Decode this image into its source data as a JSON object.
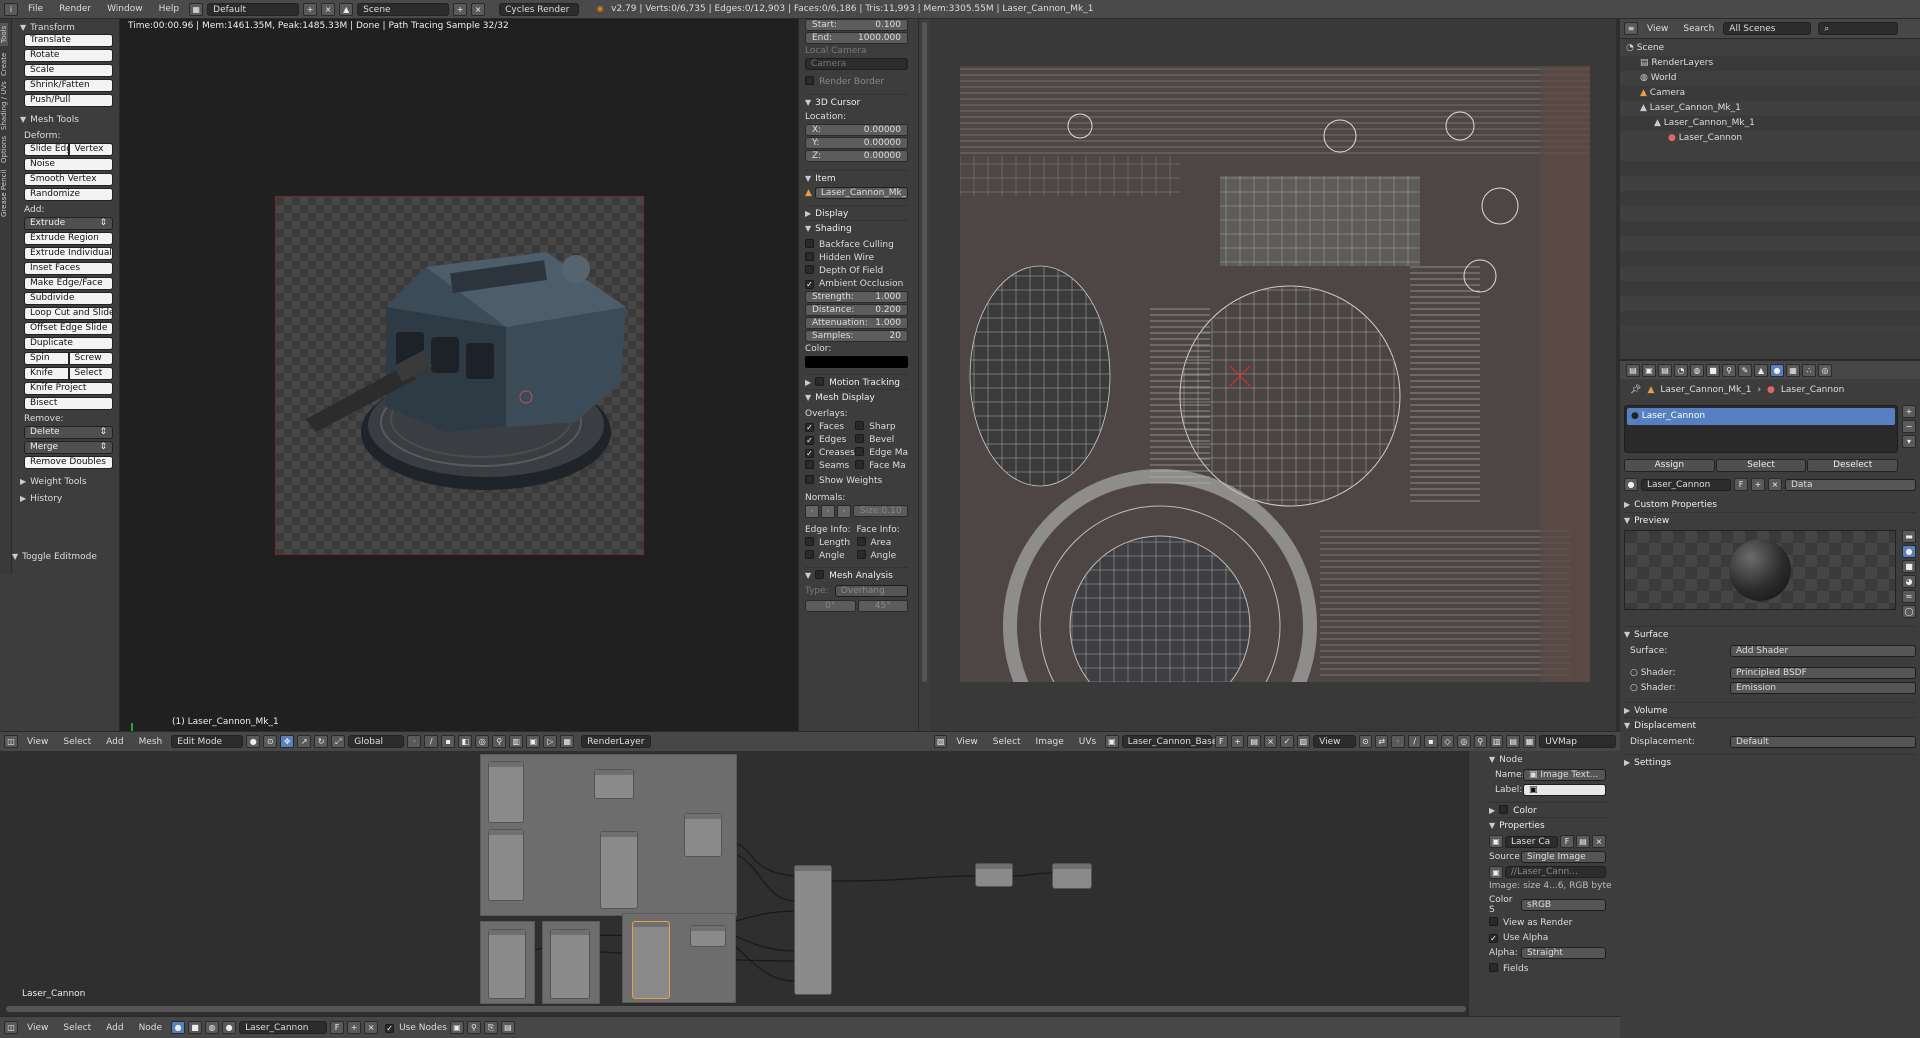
{
  "topbar": {
    "menus": [
      "File",
      "Render",
      "Window",
      "Help"
    ],
    "layout": "Default",
    "scene": "Scene",
    "engine": "Cycles Render",
    "stats": "v2.79 | Verts:0/6,735 | Edges:0/12,903 | Faces:0/6,186 | Tris:11,993 | Mem:3305.55M | Laser_Cannon_Mk_1"
  },
  "tabs": [
    "Tools",
    "Create",
    "Shading / UVs",
    "Options",
    "Grease Pencil"
  ],
  "toolshelf": {
    "transform_title": "Transform",
    "transform": [
      "Translate",
      "Rotate",
      "Scale",
      "Shrink/Fatten",
      "Push/Pull"
    ],
    "mesh_tools_title": "Mesh Tools",
    "deform_label": "Deform:",
    "slide_edge": "Slide Edge",
    "vertex": "Vertex",
    "noise": "Noise",
    "smooth_vertex": "Smooth Vertex",
    "randomize": "Randomize",
    "add_label": "Add:",
    "extrude": "Extrude",
    "add_items": [
      "Extrude Region",
      "Extrude Individual",
      "Inset Faces",
      "Make Edge/Face",
      "Subdivide",
      "Loop Cut and Slide",
      "Offset Edge Slide",
      "Duplicate"
    ],
    "spin": "Spin",
    "screw": "Screw",
    "knife": "Knife",
    "select": "Select",
    "knife_project": "Knife Project",
    "bisect": "Bisect",
    "remove_label": "Remove:",
    "delete": "Delete",
    "merge": "Merge",
    "remove_doubles": "Remove Doubles",
    "weight_tools": "Weight Tools",
    "history": "History",
    "toggle_editmode": "Toggle Editmode"
  },
  "viewport": {
    "status": "Time:00:00.96 | Mem:1461.35M, Peak:1485.33M | Done | Path Tracing Sample 32/32",
    "object_label": "(1) Laser_Cannon_Mk_1"
  },
  "props": {
    "start_label": "Start:",
    "start": "0.100",
    "end_label": "End:",
    "end": "1000.000",
    "local_camera": "Local Camera",
    "camera": "Camera",
    "render_border": "Render Border",
    "cursor_title": "3D Cursor",
    "location": "Location:",
    "x_label": "X:",
    "x": "0.00000",
    "y_label": "Y:",
    "y": "0.00000",
    "z_label": "Z:",
    "z": "0.00000",
    "item_title": "Item",
    "item_name": "Laser_Cannon_Mk_1",
    "display": "Display",
    "shading": "Shading",
    "shading_checks": [
      "Backface Culling",
      "Hidden Wire",
      "Depth Of Field",
      "Ambient Occlusion"
    ],
    "strength_label": "Strength:",
    "strength": "1.000",
    "distance_label": "Distance:",
    "distance": "0.200",
    "attenuation_label": "Attenuation:",
    "attenuation": "1.000",
    "samples_label": "Samples:",
    "samples": "20",
    "color_label": "Color:",
    "motion_tracking": "Motion Tracking",
    "mesh_display": "Mesh Display",
    "overlays": "Overlays:",
    "ov_left": [
      "Faces",
      "Edges",
      "Creases",
      "Seams"
    ],
    "ov_right": [
      "Sharp",
      "Bevel",
      "Edge Ma",
      "Face Ma"
    ],
    "show_weights": "Show Weights",
    "normals": "Normals:",
    "size": "Size:",
    "size_val": "0.10",
    "edge_info": "Edge Info:",
    "face_info": "Face Info:",
    "length": "Length",
    "area": "Area",
    "angle1": "Angle",
    "angle2": "Angle",
    "mesh_analysis": "Mesh Analysis",
    "type_label": "Type:",
    "type": "Overhang",
    "deg0": "0°",
    "deg45": "45°"
  },
  "view3d_header": {
    "view": "View",
    "select": "Select",
    "add": "Add",
    "mesh": "Mesh",
    "mode": "Edit Mode",
    "orientation": "Global",
    "layer": "RenderLayer"
  },
  "uv_header": {
    "view": "View",
    "select": "Select",
    "image": "Image",
    "uvs": "UVs",
    "image_name": "Laser_Cannon_Base...",
    "f": "F",
    "view2": "View",
    "uvmap": "UVMap"
  },
  "outliner": {
    "view": "View",
    "search": "Search",
    "filter": "All Scenes",
    "rows": [
      {
        "name": "Scene",
        "indent": 0
      },
      {
        "name": "RenderLayers",
        "indent": 1
      },
      {
        "name": "World",
        "indent": 1
      },
      {
        "name": "Camera",
        "indent": 1
      },
      {
        "name": "Laser_Cannon_Mk_1",
        "indent": 1
      },
      {
        "name": "Laser_Cannon_Mk_1",
        "indent": 2
      },
      {
        "name": "Laser_Cannon",
        "indent": 3
      }
    ]
  },
  "material": {
    "breadcrumb_obj": "Laser_Cannon_Mk_1",
    "breadcrumb_mat": "Laser_Cannon",
    "slot": "Laser_Cannon",
    "assign": "Assign",
    "select": "Select",
    "deselect": "Deselect",
    "mat_name": "Laser_Cannon",
    "f": "F",
    "data": "Data",
    "custom_props": "Custom Properties",
    "preview": "Preview",
    "surface": "Surface",
    "surface_label": "Surface:",
    "add_shader": "Add Shader",
    "shader_label1": "Shader:",
    "shader1": "Principled BSDF",
    "shader_label2": "Shader:",
    "shader2": "Emission",
    "volume": "Volume",
    "displacement": "Displacement",
    "displacement_label": "Displacement:",
    "displacement_val": "Default",
    "settings": "Settings"
  },
  "node_editor": {
    "mat_label": "Laser_Cannon",
    "view": "View",
    "select": "Select",
    "add": "Add",
    "node": "Node",
    "material": "Laser_Cannon",
    "f": "F",
    "use_nodes": "Use Nodes"
  },
  "node_panel": {
    "node_title": "Node",
    "name_label": "Name:",
    "name": "Image Text...",
    "label_label": "Label:",
    "color": "Color",
    "properties": "Properties",
    "image": "Laser Ca",
    "f": "F",
    "source_label": "Source:",
    "source": "Single Image",
    "path": "//Laser_Cann...",
    "info": "Image: size 4...6, RGB byte",
    "color_space_label": "Color S",
    "color_space": "sRGB",
    "view_as_render": "View as Render",
    "use_alpha": "Use Alpha",
    "alpha_label": "Alpha:",
    "alpha": "Straight",
    "fields": "Fields"
  }
}
